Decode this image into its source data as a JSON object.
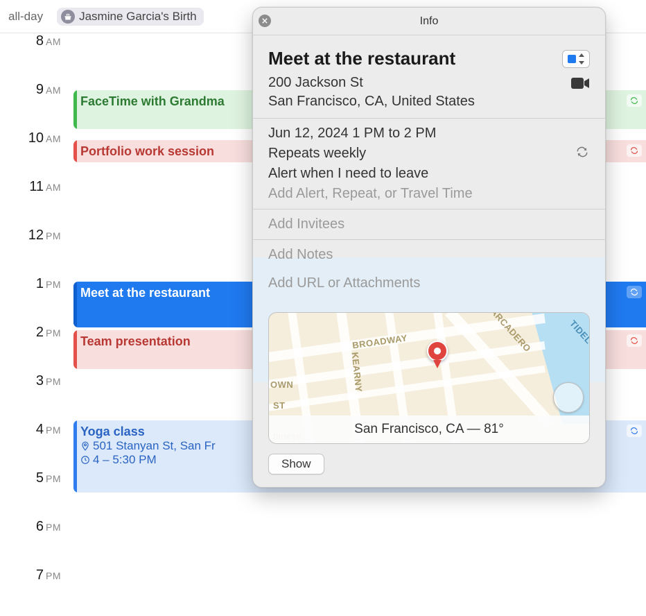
{
  "allday": {
    "label": "all-day",
    "chip_text": "Jasmine Garcia's Birth"
  },
  "hours": [
    "8",
    "9",
    "10",
    "11",
    "12",
    "1",
    "2",
    "3",
    "4",
    "5",
    "6",
    "7"
  ],
  "hour_suffix": [
    "AM",
    "AM",
    "AM",
    "AM",
    "PM",
    "PM",
    "PM",
    "PM",
    "PM",
    "PM",
    "PM",
    "PM"
  ],
  "events": {
    "facetime": {
      "title": "FaceTime with Grandma"
    },
    "portfolio": {
      "title": "Portfolio work session"
    },
    "meet": {
      "title": "Meet at the restaurant"
    },
    "team": {
      "title": "Team presentation"
    },
    "yoga": {
      "title": "Yoga class",
      "location": "501 Stanyan St, San Fr",
      "time": "4 – 5:30 PM"
    }
  },
  "popover": {
    "header": "Info",
    "title": "Meet at the restaurant",
    "location_line1": "200 Jackson St",
    "location_line2": "San Francisco, CA, United States",
    "datetime": "Jun 12, 2024  1 PM to 2 PM",
    "repeats": "Repeats weekly",
    "alert": "Alert when I need to leave",
    "add_alert": "Add Alert, Repeat, or Travel Time",
    "add_invitees": "Add Invitees",
    "add_notes": "Add Notes",
    "add_url": "Add URL or Attachments",
    "map_footer": "San Francisco, CA — 81°",
    "show_button": "Show",
    "streets": {
      "broadway": "Broadway",
      "kearny": "Kearny",
      "embarcadero": "Embarcadero",
      "own": "own",
      "st": "St",
      "tidel": "Tidel",
      "chinese": "hinese"
    }
  }
}
